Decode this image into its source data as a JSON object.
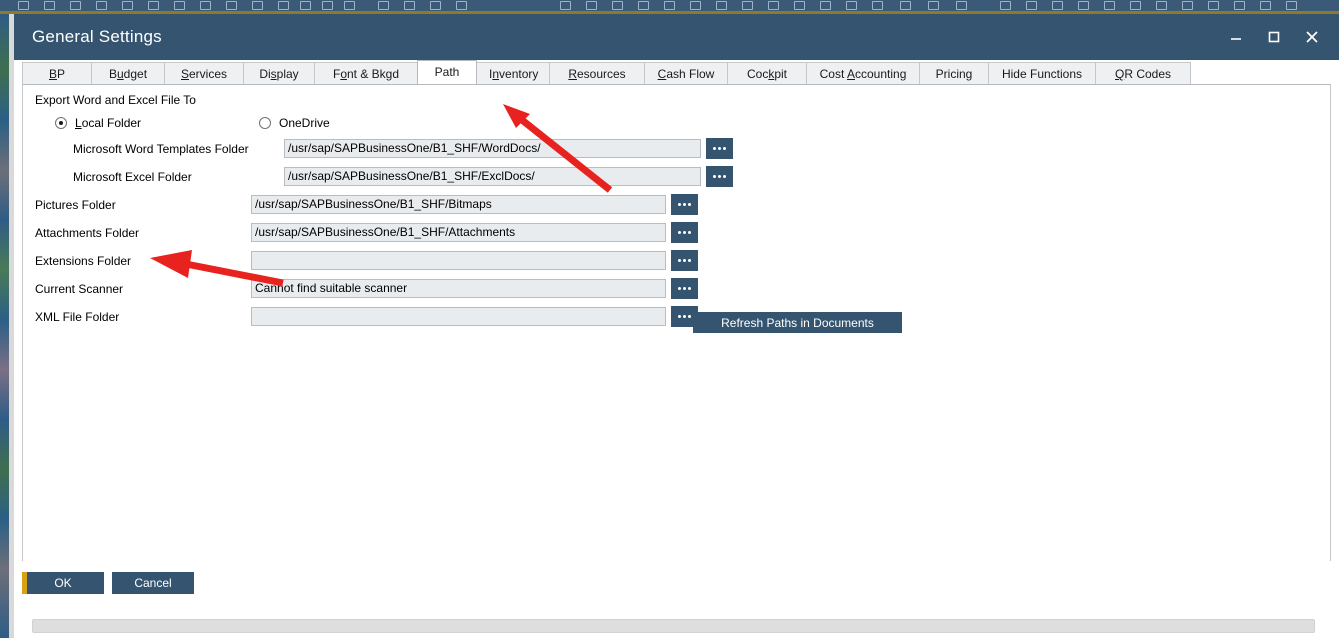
{
  "window": {
    "title": "General Settings",
    "controls": [
      {
        "name": "minimize",
        "glyph": "minimize-icon"
      },
      {
        "name": "maximize",
        "glyph": "maximize-icon"
      },
      {
        "name": "close",
        "glyph": "close-icon"
      }
    ]
  },
  "tabs": [
    {
      "label": "BP",
      "accel": "B",
      "active": false
    },
    {
      "label": "Budget",
      "accel": "u",
      "active": false
    },
    {
      "label": "Services",
      "accel": "S",
      "active": false
    },
    {
      "label": "Display",
      "accel": "s",
      "active": false
    },
    {
      "label": "Font & Bkgd",
      "accel": "o",
      "active": false
    },
    {
      "label": "Path",
      "accel": "",
      "active": true
    },
    {
      "label": "Inventory",
      "accel": "n",
      "active": false
    },
    {
      "label": "Resources",
      "accel": "R",
      "active": false
    },
    {
      "label": "Cash Flow",
      "accel": "C",
      "active": false
    },
    {
      "label": "Cockpit",
      "accel": "k",
      "active": false
    },
    {
      "label": "Cost Accounting",
      "accel": "A",
      "active": false
    },
    {
      "label": "Pricing",
      "accel": "",
      "active": false
    },
    {
      "label": "Hide Functions",
      "accel": "",
      "active": false
    },
    {
      "label": "QR Codes",
      "accel": "Q",
      "active": false
    }
  ],
  "panel": {
    "group_caption": "Export Word and Excel File To",
    "radios": [
      {
        "label": "Local Folder",
        "accel": "L",
        "checked": true
      },
      {
        "label": "OneDrive",
        "accel": "",
        "checked": false
      }
    ],
    "fields": [
      {
        "label": "Microsoft Word Templates Folder",
        "value": "/usr/sap/SAPBusinessOne/B1_SHF/WordDocs/",
        "indented": true
      },
      {
        "label": "Microsoft Excel Folder",
        "value": "/usr/sap/SAPBusinessOne/B1_SHF/ExclDocs/",
        "indented": true
      },
      {
        "label": "Pictures Folder",
        "value": "/usr/sap/SAPBusinessOne/B1_SHF/Bitmaps",
        "indented": false
      },
      {
        "label": "Attachments Folder",
        "value": "/usr/sap/SAPBusinessOne/B1_SHF/Attachments",
        "indented": false
      },
      {
        "label": "Extensions Folder",
        "value": "",
        "indented": false
      },
      {
        "label": "Current Scanner",
        "value": "Cannot find suitable scanner",
        "indented": false
      },
      {
        "label": "XML File Folder",
        "value": "",
        "indented": false
      }
    ],
    "browse_button_label": "...",
    "refresh_button_label": "Refresh Paths in Documents"
  },
  "footer": {
    "ok_label": "OK",
    "cancel_label": "Cancel"
  },
  "colors": {
    "title_bar": "#34546f",
    "accent_gold": "#d9a116",
    "field_bg": "#e9ecef",
    "annotation_arrow": "#e8231f"
  }
}
